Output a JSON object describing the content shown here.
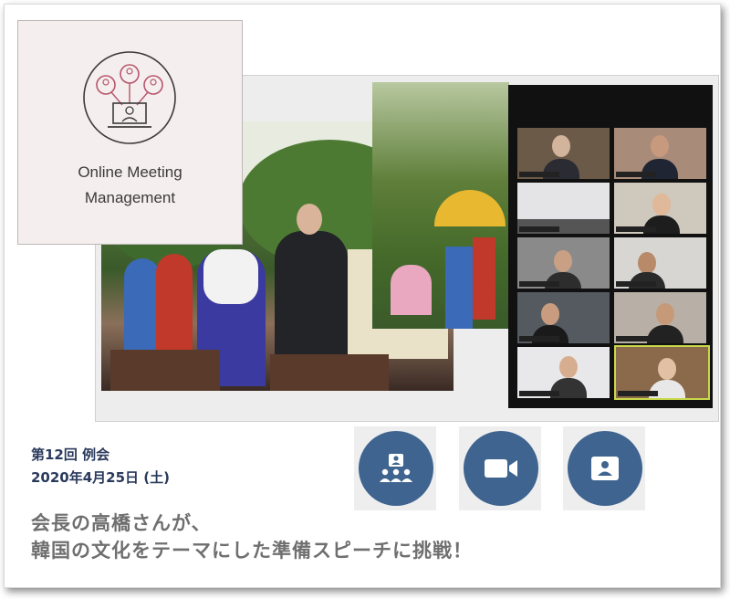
{
  "card": {
    "title_line1": "Online Meeting",
    "title_line2": "Management",
    "icon": "meeting-network-icon"
  },
  "meeting": {
    "session": "第12回 例会",
    "date": "2020年4月25日 (土)"
  },
  "headline": {
    "line1": "会長の高橋さんが、",
    "line2": "韓国の文化をテーマにした準備スピーチに挑戦！"
  },
  "buttons": [
    {
      "icon": "participants-icon"
    },
    {
      "icon": "video-camera-icon"
    },
    {
      "icon": "contact-card-icon"
    }
  ],
  "colors": {
    "button": "#3f6490",
    "meta_text": "#2a3a5c",
    "headline_text": "#6f6f6f",
    "card_bg": "#f4eeee",
    "logo_accent": "#b8556a"
  },
  "video_grid": {
    "columns": 2,
    "rows": 5,
    "active_tile": 9
  }
}
